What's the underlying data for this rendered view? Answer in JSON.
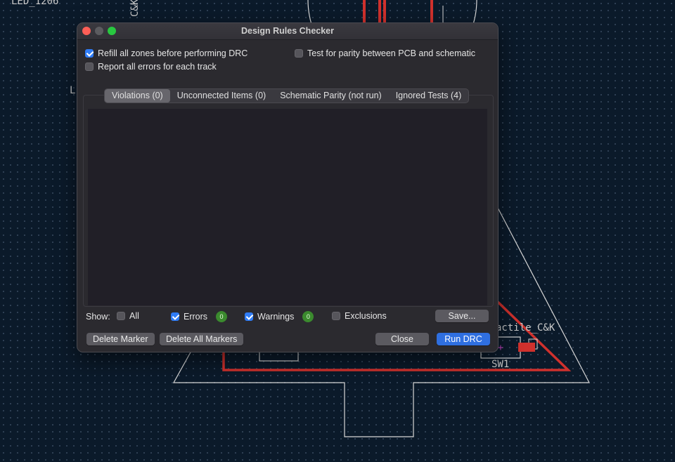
{
  "background": {
    "labels": [
      "LED_1206",
      "C&K",
      "L",
      "actile_C&K",
      "SW1"
    ],
    "colors": {
      "board": "#0b1a2a",
      "track": "#d0312d",
      "outline": "#d8d8d8"
    }
  },
  "dialog": {
    "title": "Design Rules Checker",
    "options": {
      "refill_zones": {
        "label": "Refill all zones before performing DRC",
        "checked": true
      },
      "report_all_errors": {
        "label": "Report all errors for each track",
        "checked": false
      },
      "test_parity": {
        "label": "Test for parity between PCB and schematic",
        "checked": false
      }
    },
    "tabs": [
      {
        "label": "Violations (0)",
        "active": true
      },
      {
        "label": "Unconnected Items (0)",
        "active": false
      },
      {
        "label": "Schematic Parity (not run)",
        "active": false
      },
      {
        "label": "Ignored Tests (4)",
        "active": false
      }
    ],
    "show": {
      "label": "Show:",
      "all": {
        "label": "All",
        "checked": false
      },
      "errors": {
        "label": "Errors",
        "checked": true,
        "count": "0"
      },
      "warnings": {
        "label": "Warnings",
        "checked": true,
        "count": "0"
      },
      "exclusions": {
        "label": "Exclusions",
        "checked": false
      }
    },
    "buttons": {
      "save": "Save...",
      "delete_marker": "Delete Marker",
      "delete_all_markers": "Delete All Markers",
      "close": "Close",
      "run_drc": "Run DRC"
    }
  }
}
